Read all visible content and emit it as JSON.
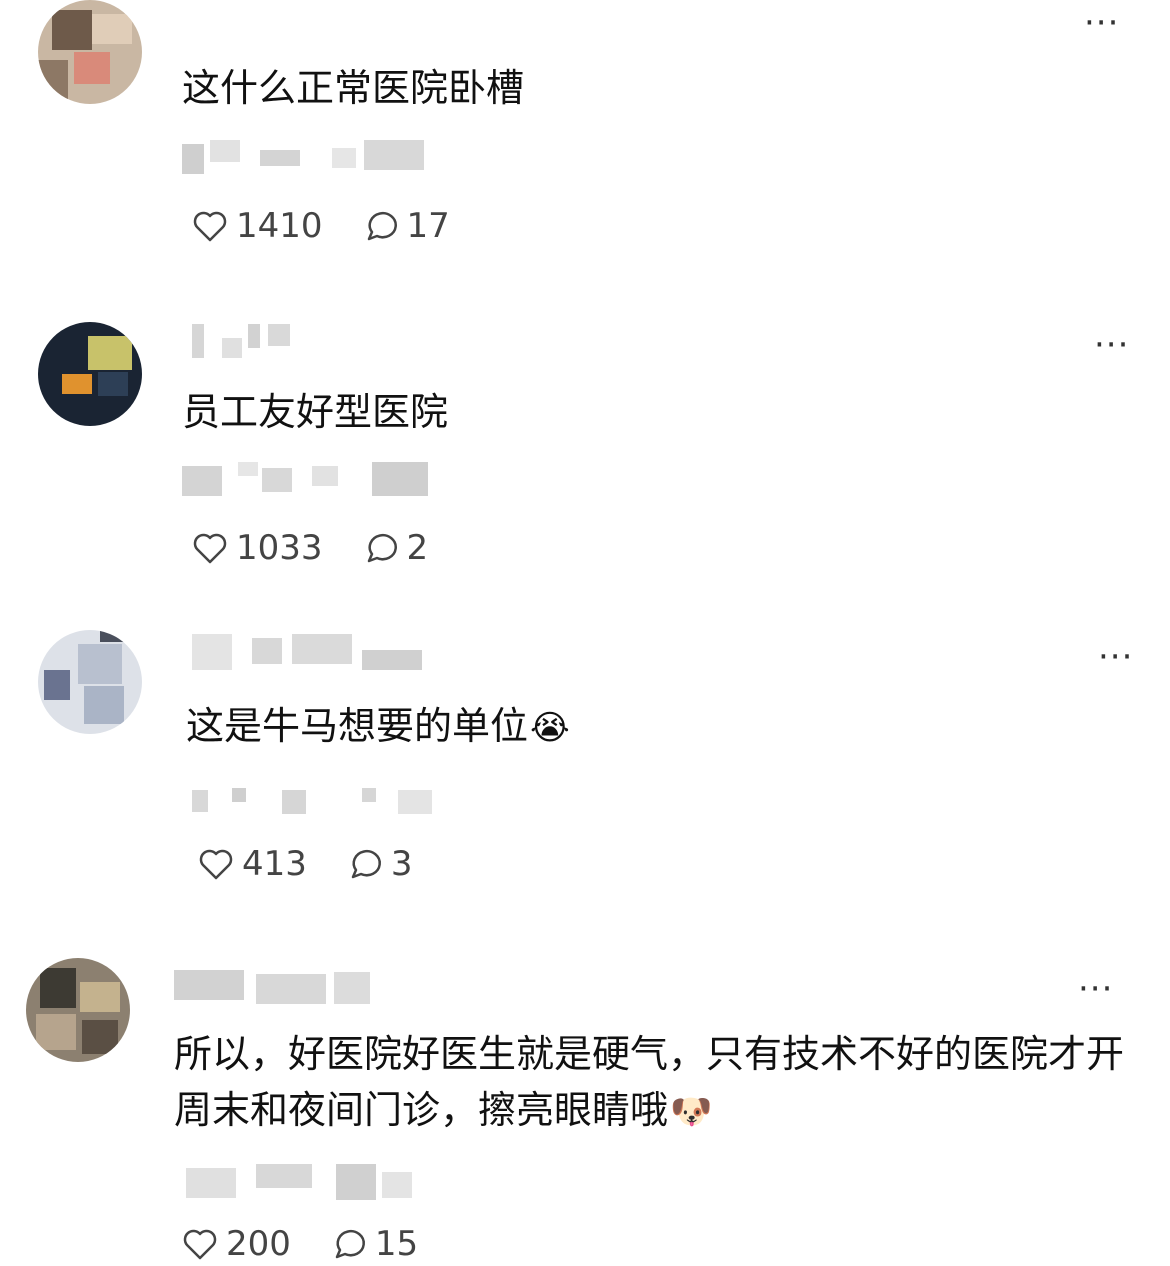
{
  "comments": [
    {
      "text": "这什么正常医院卧槽",
      "emoji": "",
      "likes": "1410",
      "replies": "17",
      "more_label": "···"
    },
    {
      "text": "员工友好型医院",
      "emoji": "",
      "likes": "1033",
      "replies": "2",
      "more_label": "···"
    },
    {
      "text": "这是牛马想要的单位",
      "emoji": "😭",
      "likes": "413",
      "replies": "3",
      "more_label": "···"
    },
    {
      "text": "所以，好医院好医生就是硬气，只有技术不好的医院才开周末和夜间门诊，擦亮眼睛哦",
      "emoji": "🐶",
      "likes": "200",
      "replies": "15",
      "more_label": "···"
    }
  ],
  "icons": {
    "like": "heart-outline-icon",
    "reply": "speech-bubble-icon",
    "more": "ellipsis-icon"
  },
  "colors": {
    "text": "#111111",
    "count": "#444444",
    "blur": "#d9d9d9"
  }
}
